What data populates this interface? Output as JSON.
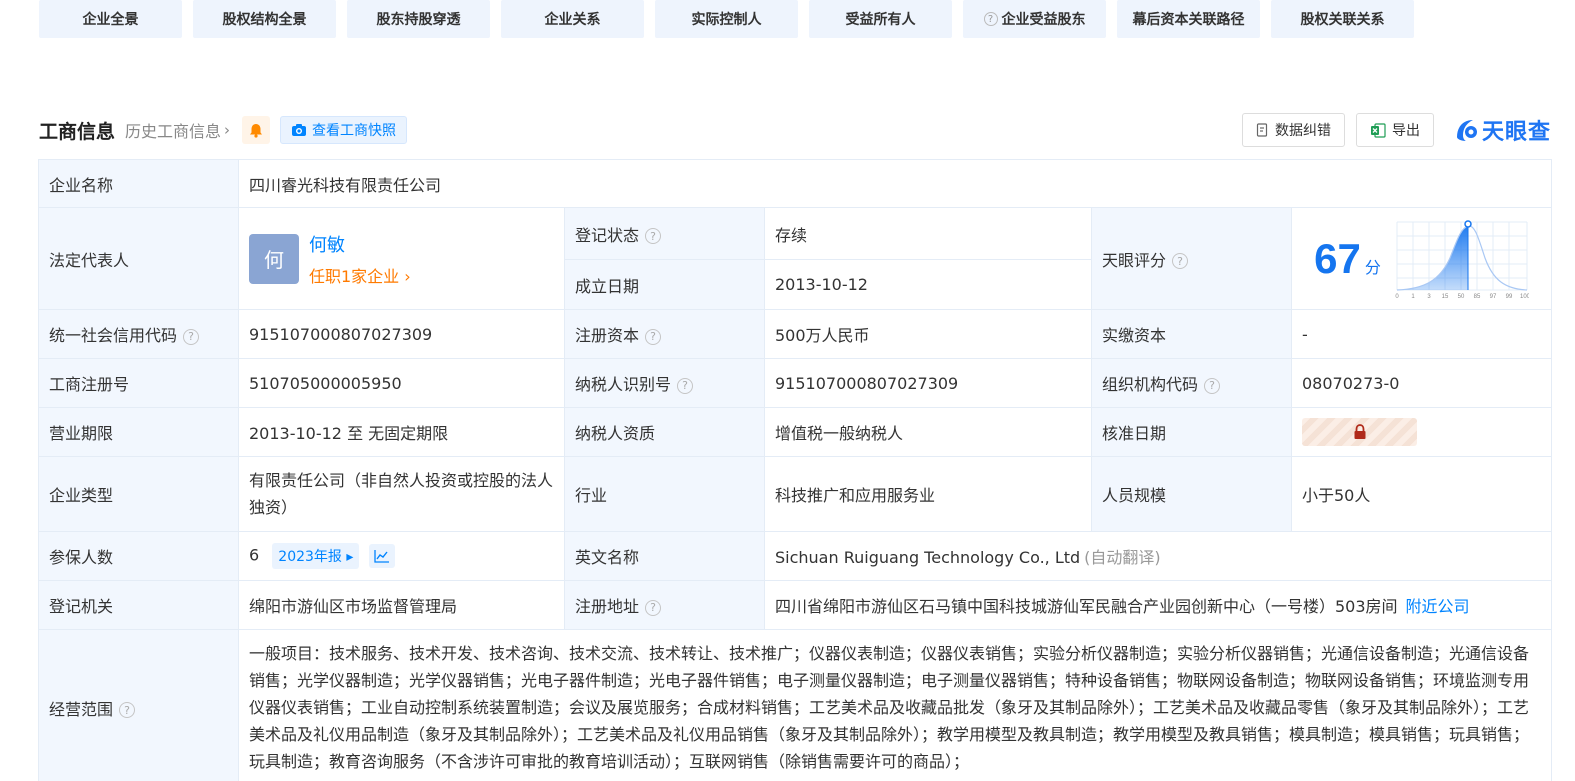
{
  "tabs": [
    {
      "label": "企业全景",
      "help": false
    },
    {
      "label": "股权结构全景",
      "help": false
    },
    {
      "label": "股东持股穿透",
      "help": false
    },
    {
      "label": "企业关系",
      "help": false
    },
    {
      "label": "实际控制人",
      "help": false
    },
    {
      "label": "受益所有人",
      "help": false
    },
    {
      "label": "企业受益股东",
      "help": true
    },
    {
      "label": "幕后资本关联路径",
      "help": false
    },
    {
      "label": "股权关联关系",
      "help": false
    }
  ],
  "section": {
    "title": "工商信息",
    "history_link": "历史工商信息",
    "snapshot_btn": "查看工商快照",
    "correct_btn": "数据纠错",
    "export_btn": "导出",
    "logo_text": "天眼查"
  },
  "company": {
    "name_label": "企业名称",
    "name": "四川睿光科技有限责任公司",
    "legal_rep_label": "法定代表人",
    "legal_rep_avatar": "何",
    "legal_rep_name": "何敏",
    "legal_rep_sub": "任职1家企业",
    "reg_status_label": "登记状态",
    "reg_status": "存续",
    "found_date_label": "成立日期",
    "found_date": "2013-10-12",
    "score_label": "天眼评分",
    "score": "67",
    "score_unit": "分",
    "score_ticks": [
      "0",
      "1",
      "3",
      "15",
      "50",
      "85",
      "97",
      "99",
      "100"
    ],
    "credit_code_label": "统一社会信用代码",
    "credit_code": "915107000807027309",
    "reg_capital_label": "注册资本",
    "reg_capital": "500万人民币",
    "paid_capital_label": "实缴资本",
    "paid_capital": "-",
    "biz_reg_no_label": "工商注册号",
    "biz_reg_no": "510705000005950",
    "taxpayer_id_label": "纳税人识别号",
    "taxpayer_id": "915107000807027309",
    "org_code_label": "组织机构代码",
    "org_code": "08070273-0",
    "term_label": "营业期限",
    "term": "2013-10-12 至 无固定期限",
    "taxpayer_qual_label": "纳税人资质",
    "taxpayer_qual": "增值税一般纳税人",
    "approve_date_label": "核准日期",
    "type_label": "企业类型",
    "type": "有限责任公司（非自然人投资或控股的法人独资）",
    "industry_label": "行业",
    "industry": "科技推广和应用服务业",
    "staff_label": "人员规模",
    "staff": "小于50人",
    "insured_label": "参保人数",
    "insured": "6",
    "insured_report": "2023年报",
    "en_name_label": "英文名称",
    "en_name": "Sichuan Ruiguang Technology Co., Ltd",
    "en_name_note": "(自动翻译)",
    "authority_label": "登记机关",
    "authority": "绵阳市游仙区市场监督管理局",
    "address_label": "注册地址",
    "address": "四川省绵阳市游仙区石马镇中国科技城游仙军民融合产业园创新中心（一号楼）503房间",
    "nearby": "附近公司",
    "scope_label": "经营范围",
    "scope": "一般项目：技术服务、技术开发、技术咨询、技术交流、技术转让、技术推广；仪器仪表制造；仪器仪表销售；实验分析仪器制造；实验分析仪器销售；光通信设备制造；光通信设备销售；光学仪器制造；光学仪器销售；光电子器件制造；光电子器件销售；电子测量仪器制造；电子测量仪器销售；特种设备销售；物联网设备制造；物联网设备销售；环境监测专用仪器仪表销售；工业自动控制系统装置制造；会议及展览服务；合成材料销售；工艺美术品及收藏品批发（象牙及其制品除外）；工艺美术品及收藏品零售（象牙及其制品除外）；工艺美术品及礼仪用品制造（象牙及其制品除外）；工艺美术品及礼仪用品销售（象牙及其制品除外）；教学用模型及教具制造；教学用模型及教具销售；模具制造；模具销售；玩具销售；玩具制造；教育咨询服务（不含涉许可审批的教育培训活动）；互联网销售（除销售需要许可的商品）；"
  },
  "colors": {
    "accent": "#0084ff",
    "green": "#1aa34a",
    "orange": "#ff7a00",
    "label_bg": "#f2f7fe"
  }
}
